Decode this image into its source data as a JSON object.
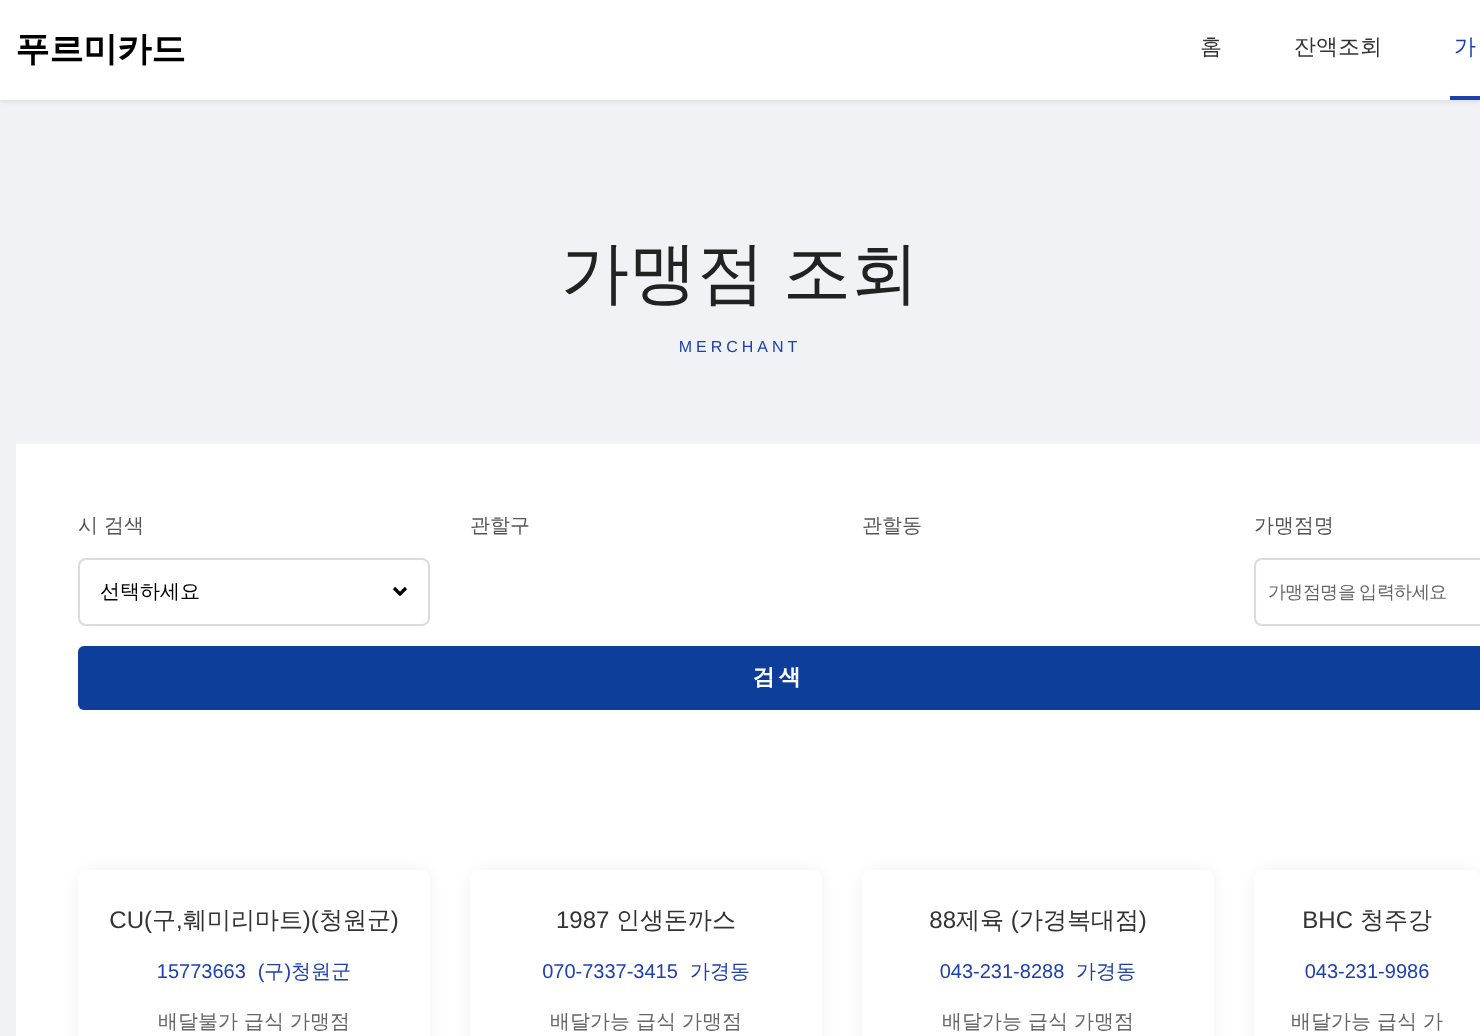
{
  "header": {
    "brand": "푸르미카드",
    "nav": [
      {
        "label": "홈",
        "selected": false
      },
      {
        "label": "잔액조회",
        "selected": false
      },
      {
        "label": "가",
        "selected": true
      }
    ]
  },
  "hero": {
    "title": "가맹점 조회",
    "subtitle": "MERCHANT"
  },
  "search": {
    "fields": [
      {
        "label": "시 검색",
        "kind": "select",
        "value": "선택하세요"
      },
      {
        "label": "관할구",
        "kind": "empty"
      },
      {
        "label": "관할동",
        "kind": "empty"
      },
      {
        "label": "가맹점명",
        "kind": "input",
        "placeholder": "가맹점명을 입력하세요"
      }
    ],
    "button": "검색"
  },
  "merchants": [
    {
      "name": "CU(구,훼미리마트)(청원군)",
      "phone": "15773663",
      "area": "(구)청원군",
      "info": "배달불가 급식 가맹점"
    },
    {
      "name": "1987 인생돈까스",
      "phone": "070-7337-3415",
      "area": "가경동",
      "info": "배달가능 급식 가맹점"
    },
    {
      "name": "88제육 (가경복대점)",
      "phone": "043-231-8288",
      "area": "가경동",
      "info": "배달가능 급식 가맹점"
    },
    {
      "name": "BHC 청주강",
      "phone": "043-231-9986",
      "info": "배달가능 급식 가"
    }
  ]
}
